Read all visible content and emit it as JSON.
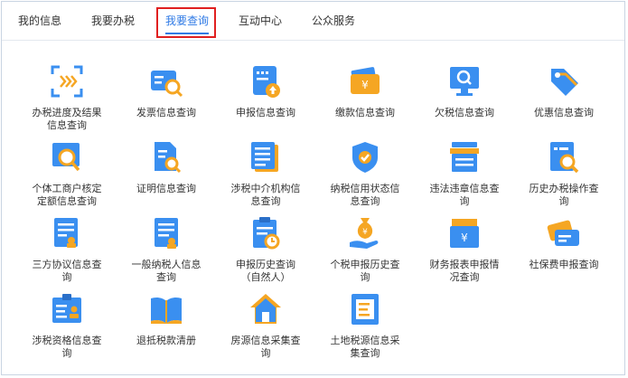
{
  "tabs": [
    {
      "label": "我的信息"
    },
    {
      "label": "我要办税"
    },
    {
      "label": "我要查询"
    },
    {
      "label": "互动中心"
    },
    {
      "label": "公众服务"
    }
  ],
  "active_tab": "我要查询",
  "accent_color": "#2f7ae5",
  "icon_blue": "#3a8ff0",
  "icon_orange": "#f5a623",
  "highlight_color": "#e02020",
  "items": [
    {
      "label": "办税进度及结果\n信息查询",
      "icon": "progress-scan-icon"
    },
    {
      "label": "发票信息查询",
      "icon": "invoice-search-icon"
    },
    {
      "label": "申报信息查询",
      "icon": "declaration-upload-icon"
    },
    {
      "label": "缴款信息查询",
      "icon": "payment-wallet-icon"
    },
    {
      "label": "欠税信息查询",
      "icon": "monitor-search-icon"
    },
    {
      "label": "优惠信息查询",
      "icon": "discount-tag-icon"
    },
    {
      "label": "个体工商户核定\n定额信息查询",
      "icon": "screen-search-icon"
    },
    {
      "label": "证明信息查询",
      "icon": "certificate-search-icon"
    },
    {
      "label": "涉税中介机构信\n息查询",
      "icon": "agency-document-icon"
    },
    {
      "label": "纳税信用状态信\n息查询",
      "icon": "credit-shield-icon"
    },
    {
      "label": "违法违章信息查\n询",
      "icon": "violation-printer-icon"
    },
    {
      "label": "历史办税操作查\n询",
      "icon": "history-search-icon"
    },
    {
      "label": "三方协议信息查\n询",
      "icon": "agreement-stamp-icon"
    },
    {
      "label": "一般纳税人信息\n查询",
      "icon": "taxpayer-document-icon"
    },
    {
      "label": "申报历史查询\n（自然人）",
      "icon": "clipboard-history-icon"
    },
    {
      "label": "个税申报历史查\n询",
      "icon": "money-bag-hand-icon"
    },
    {
      "label": "财务报表申报情\n况查询",
      "icon": "financial-box-icon"
    },
    {
      "label": "社保费申报查询",
      "icon": "insurance-cards-icon"
    },
    {
      "label": "涉税资格信息查\n询",
      "icon": "qualification-card-icon"
    },
    {
      "label": "退抵税款清册",
      "icon": "open-book-icon"
    },
    {
      "label": "房源信息采集查\n询",
      "icon": "house-icon"
    },
    {
      "label": "土地税源信息采\n集查询",
      "icon": "land-document-icon"
    }
  ]
}
